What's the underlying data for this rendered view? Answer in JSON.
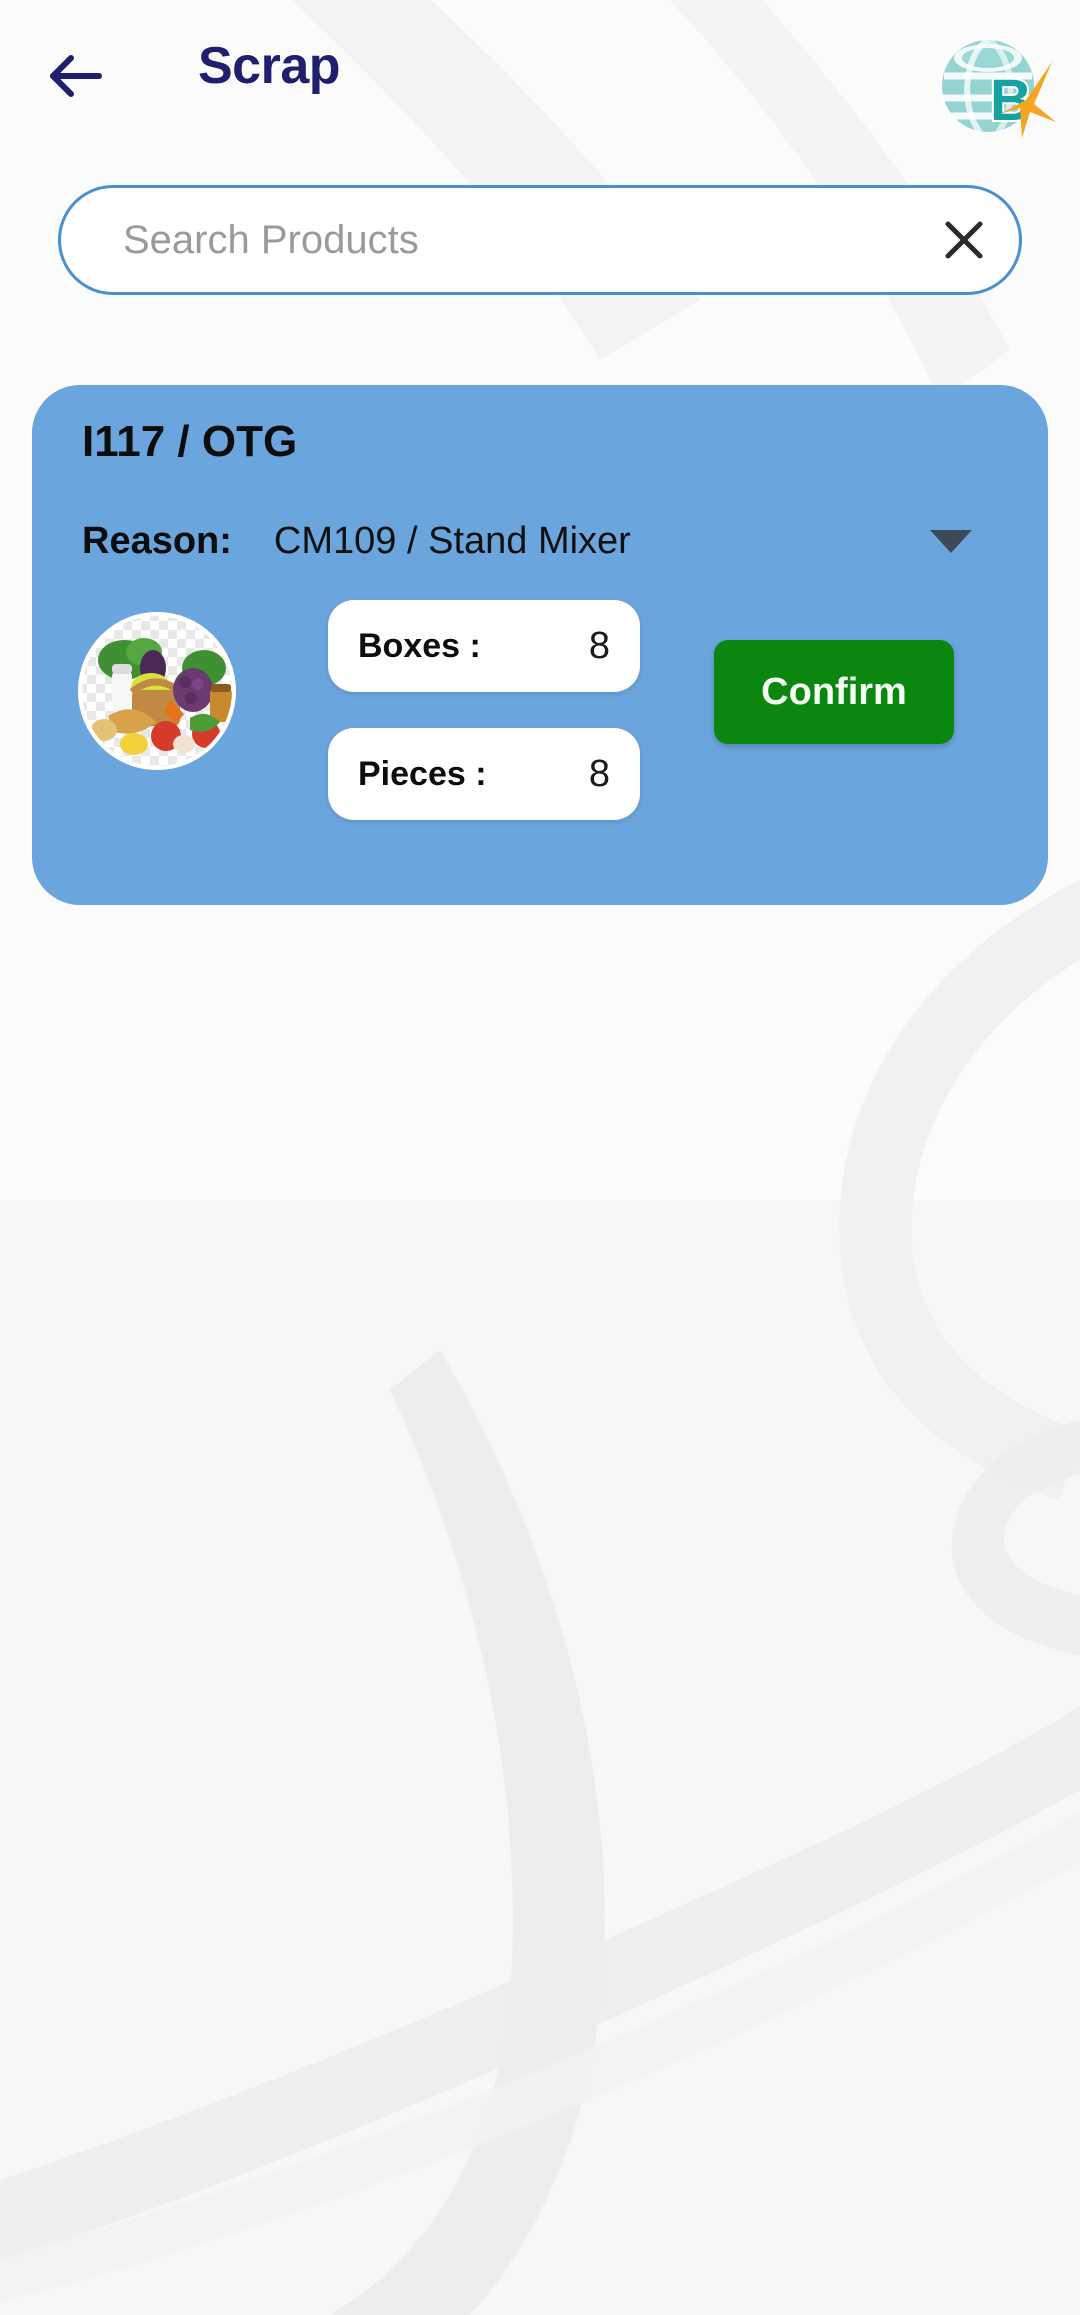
{
  "header": {
    "title": "Scrap",
    "back_icon": "arrow-left-icon",
    "logo_icon": "brand-globe-b-logo",
    "title_color": "#1f1f6e"
  },
  "search": {
    "placeholder": "Search Products",
    "value": "",
    "clear_icon": "close-x-icon",
    "border_color": "#4a8fd0"
  },
  "card": {
    "title": "I117 / OTG",
    "background_color": "#6ba5dd",
    "reason": {
      "label": "Reason:",
      "value": "CM109 / Stand Mixer",
      "dropdown_icon": "chevron-down-icon"
    },
    "thumbnail_icon": "product-image-groceries",
    "fields": [
      {
        "label": "Boxes :",
        "value": "8"
      },
      {
        "label": "Pieces :",
        "value": "8"
      }
    ],
    "confirm_label": "Confirm",
    "confirm_color": "#0b8710"
  }
}
